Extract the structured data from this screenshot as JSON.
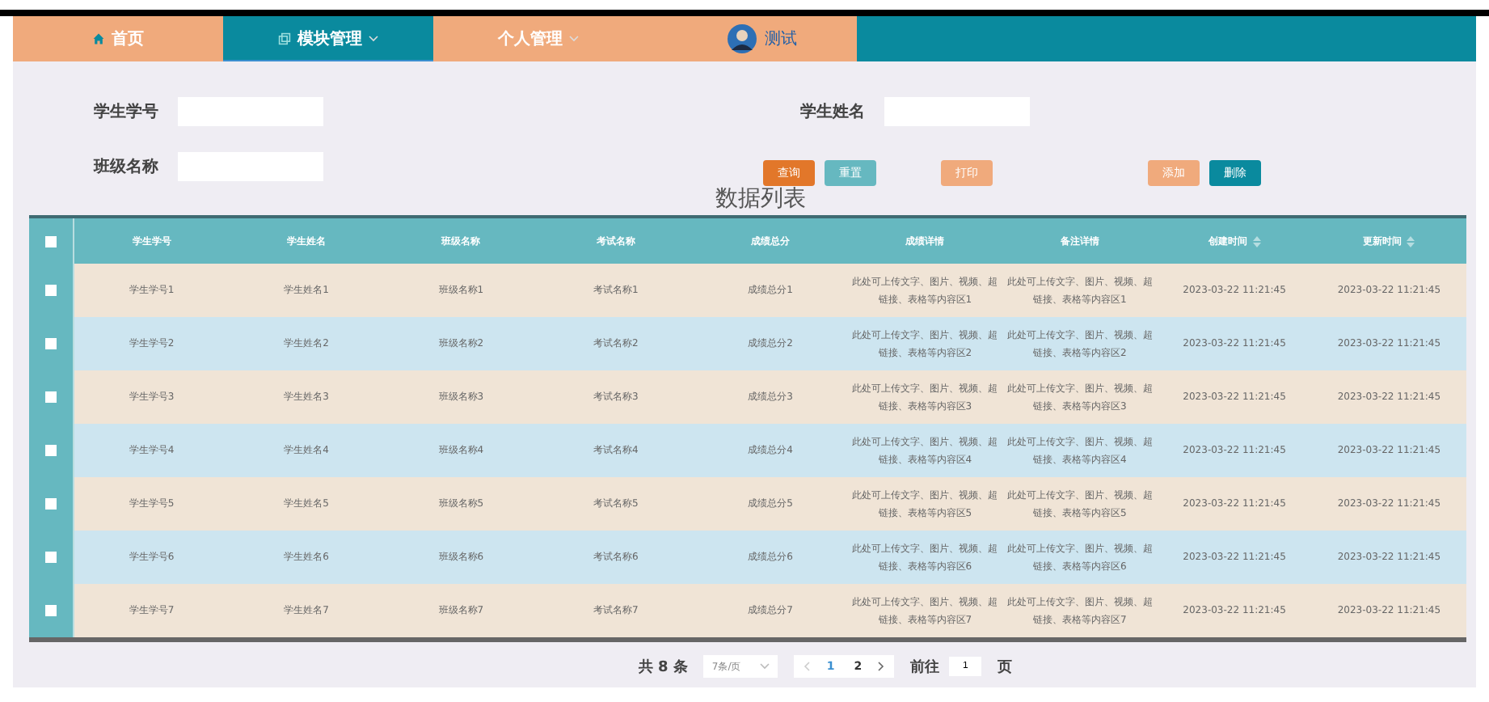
{
  "nav": {
    "items": [
      {
        "label": "首页",
        "selected": false,
        "has_menu": false
      },
      {
        "label": "模块管理",
        "selected": true,
        "has_menu": true
      },
      {
        "label": "个人管理",
        "selected": false,
        "has_menu": true
      }
    ],
    "user": "测试"
  },
  "search": {
    "fields": [
      {
        "label": "学生学号"
      },
      {
        "label": "学生姓名"
      },
      {
        "label": "班级名称"
      }
    ],
    "buttons": [
      {
        "label": "查询",
        "kind": "search"
      },
      {
        "label": "重置",
        "kind": "reset"
      },
      {
        "label": "打印",
        "kind": "print"
      },
      {
        "label": "添加",
        "kind": "add"
      },
      {
        "label": "删除",
        "kind": "delete"
      }
    ]
  },
  "table": {
    "title": "数据列表",
    "all_checked": false,
    "columns": [
      {
        "label": "学生学号",
        "sortable": false
      },
      {
        "label": "学生姓名",
        "sortable": false
      },
      {
        "label": "班级名称",
        "sortable": false
      },
      {
        "label": "考试名称",
        "sortable": false
      },
      {
        "label": "成绩总分",
        "sortable": false
      },
      {
        "label": "成绩详情",
        "sortable": false
      },
      {
        "label": "备注详情",
        "sortable": false
      },
      {
        "label": "创建时间",
        "sortable": true
      },
      {
        "label": "更新时间",
        "sortable": true
      }
    ],
    "rows": [
      {
        "checked": false,
        "cells": [
          "学生学号1",
          "学生姓名1",
          "班级名称1",
          "考试名称1",
          "成绩总分1",
          "此处可上传文字、图片、视频、超链接、表格等内容区1",
          "此处可上传文字、图片、视频、超链接、表格等内容区1",
          "2023-03-22 11:21:45",
          "2023-03-22 11:21:45"
        ]
      },
      {
        "checked": false,
        "cells": [
          "学生学号2",
          "学生姓名2",
          "班级名称2",
          "考试名称2",
          "成绩总分2",
          "此处可上传文字、图片、视频、超链接、表格等内容区2",
          "此处可上传文字、图片、视频、超链接、表格等内容区2",
          "2023-03-22 11:21:45",
          "2023-03-22 11:21:45"
        ]
      },
      {
        "checked": false,
        "cells": [
          "学生学号3",
          "学生姓名3",
          "班级名称3",
          "考试名称3",
          "成绩总分3",
          "此处可上传文字、图片、视频、超链接、表格等内容区3",
          "此处可上传文字、图片、视频、超链接、表格等内容区3",
          "2023-03-22 11:21:45",
          "2023-03-22 11:21:45"
        ]
      },
      {
        "checked": false,
        "cells": [
          "学生学号4",
          "学生姓名4",
          "班级名称4",
          "考试名称4",
          "成绩总分4",
          "此处可上传文字、图片、视频、超链接、表格等内容区4",
          "此处可上传文字、图片、视频、超链接、表格等内容区4",
          "2023-03-22 11:21:45",
          "2023-03-22 11:21:45"
        ]
      },
      {
        "checked": false,
        "cells": [
          "学生学号5",
          "学生姓名5",
          "班级名称5",
          "考试名称5",
          "成绩总分5",
          "此处可上传文字、图片、视频、超链接、表格等内容区5",
          "此处可上传文字、图片、视频、超链接、表格等内容区5",
          "2023-03-22 11:21:45",
          "2023-03-22 11:21:45"
        ]
      },
      {
        "checked": false,
        "cells": [
          "学生学号6",
          "学生姓名6",
          "班级名称6",
          "考试名称6",
          "成绩总分6",
          "此处可上传文字、图片、视频、超链接、表格等内容区6",
          "此处可上传文字、图片、视频、超链接、表格等内容区6",
          "2023-03-22 11:21:45",
          "2023-03-22 11:21:45"
        ]
      },
      {
        "checked": false,
        "cells": [
          "学生学号7",
          "学生姓名7",
          "班级名称7",
          "考试名称7",
          "成绩总分7",
          "此处可上传文字、图片、视频、超链接、表格等内容区7",
          "此处可上传文字、图片、视频、超链接、表格等内容区7",
          "2023-03-22 11:21:45",
          "2023-03-22 11:21:45"
        ]
      }
    ]
  },
  "pagination": {
    "total": "共 8 条",
    "page_size": "7条/页",
    "pages": [
      {
        "label": "1",
        "selected": true
      },
      {
        "label": "2",
        "selected": false
      }
    ],
    "goto_label": "前往",
    "goto_value": "1",
    "page_suffix": "页"
  }
}
